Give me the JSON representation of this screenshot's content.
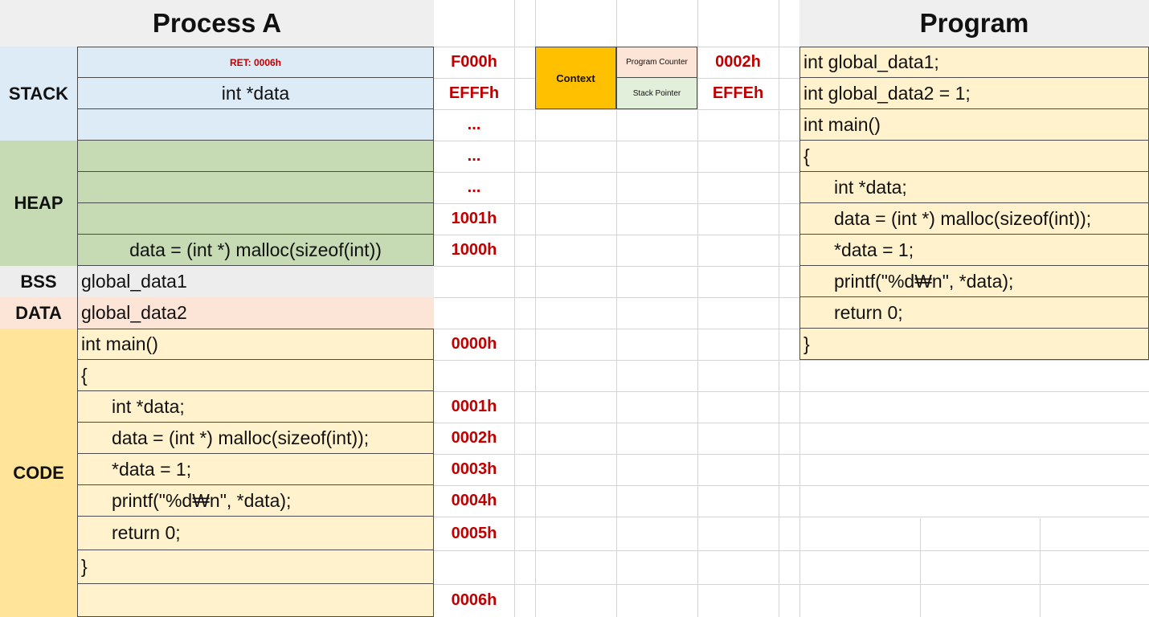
{
  "process_title": "Process A",
  "program_title": "Program",
  "segments": {
    "stack": "STACK",
    "heap": "HEAP",
    "bss": "BSS",
    "data": "DATA",
    "code": "CODE"
  },
  "stack_cells": [
    "RET: 0006h",
    "int *data",
    ""
  ],
  "heap_cells": [
    "",
    "",
    "",
    "data = (int *) malloc(sizeof(int))"
  ],
  "bss_cell": "global_data1",
  "data_cell": "global_data2",
  "code_cells": [
    "int main()",
    "{",
    "int *data;",
    "data = (int *) malloc(sizeof(int));",
    "*data = 1;",
    "printf(\"%d₩n\", *data);",
    "return 0;",
    "}",
    ""
  ],
  "addresses": [
    "F000h",
    "EFFFh",
    "...",
    "...",
    "...",
    "1001h",
    "1000h",
    "",
    "",
    "0000h",
    "",
    "0001h",
    "0002h",
    "0003h",
    "0004h",
    "0005h",
    "",
    "0006h"
  ],
  "context": {
    "label": "Context",
    "program_counter_label": "Program Counter",
    "program_counter_value": "0002h",
    "stack_pointer_label": "Stack Pointer",
    "stack_pointer_value": "EFFEh"
  },
  "program_lines": [
    "int global_data1;",
    "int global_data2 = 1;",
    "int main()",
    "{",
    "int *data;",
    "data = (int *) malloc(sizeof(int));",
    "*data = 1;",
    "printf(\"%d₩n\", *data);",
    "return 0;",
    "}"
  ],
  "colors": {
    "stack": "#ddebf7",
    "heap": "#c6dbb4",
    "bss": "#ededed",
    "data": "#fce4d6",
    "code": "#fff2cc",
    "code_label": "#ffe49a",
    "context": "#ffc000",
    "pc": "#fce4d6",
    "sp": "#e2efda",
    "address": "#c00000"
  }
}
